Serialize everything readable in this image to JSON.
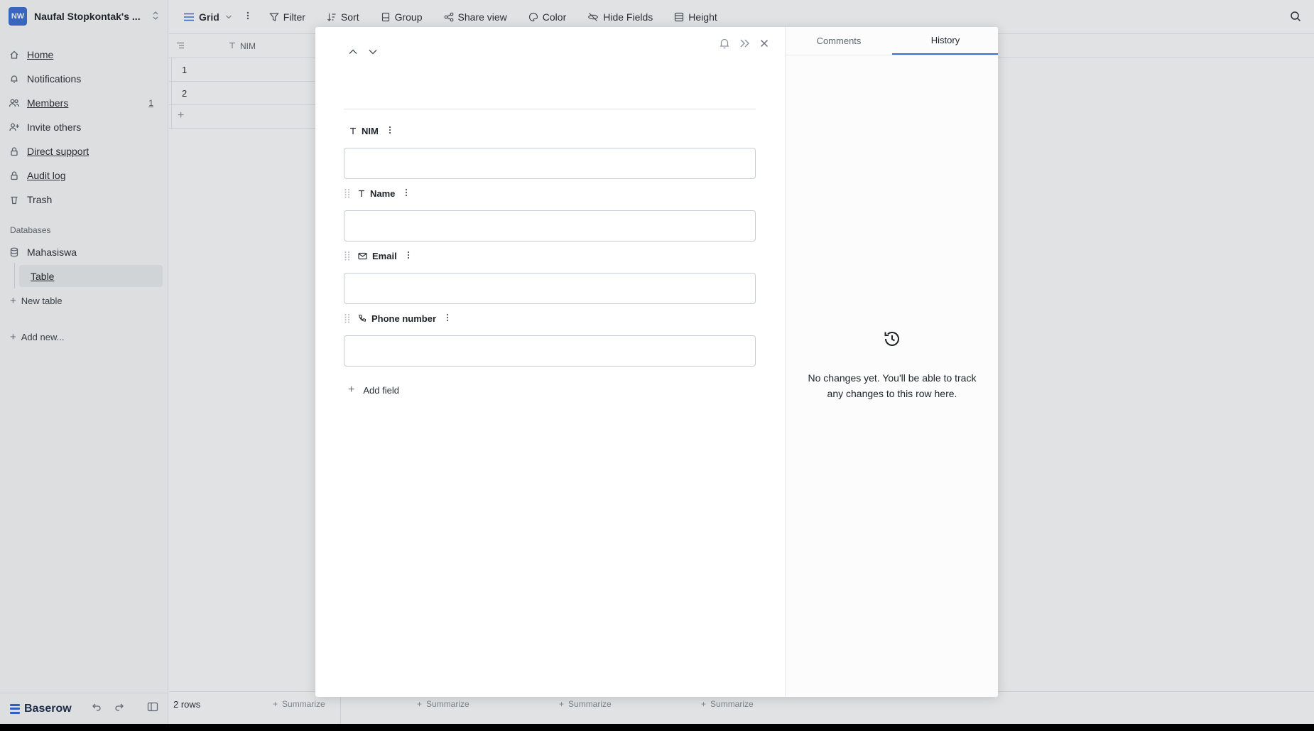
{
  "workspace": {
    "initials": "NW",
    "name": "Naufal Stopkontak's ..."
  },
  "sidebar": {
    "items": [
      {
        "label": "Home",
        "icon": "home-icon"
      },
      {
        "label": "Notifications",
        "icon": "bell-icon"
      },
      {
        "label": "Members",
        "icon": "users-icon",
        "count": "1"
      },
      {
        "label": "Invite others",
        "icon": "user-plus-icon"
      },
      {
        "label": "Direct support",
        "icon": "lock-icon"
      },
      {
        "label": "Audit log",
        "icon": "lock-icon"
      },
      {
        "label": "Trash",
        "icon": "trash-icon"
      }
    ],
    "databases_heading": "Databases",
    "database": "Mahasiswa",
    "table": "Table",
    "new_table": "New table",
    "add_new": "Add new..."
  },
  "footer": {
    "brand": "Baserow",
    "rows": "2 rows",
    "summarize": "Summarize"
  },
  "toolbar": {
    "view": "Grid",
    "filter": "Filter",
    "sort": "Sort",
    "group": "Group",
    "share": "Share view",
    "color": "Color",
    "hide": "Hide Fields",
    "height": "Height"
  },
  "grid": {
    "column": "NIM",
    "rows": [
      "1",
      "2"
    ]
  },
  "modal": {
    "fields": [
      {
        "label": "NIM",
        "type_icon": "text-icon"
      },
      {
        "label": "Name",
        "type_icon": "text-icon"
      },
      {
        "label": "Email",
        "type_icon": "mail-icon"
      },
      {
        "label": "Phone number",
        "type_icon": "phone-icon"
      }
    ],
    "add_field": "Add field",
    "tabs": [
      "Comments",
      "History"
    ],
    "active_tab": "History",
    "history_empty": "No changes yet. You'll be able to track any changes to this row here."
  },
  "colors": {
    "accent": "#3b6fd6"
  }
}
